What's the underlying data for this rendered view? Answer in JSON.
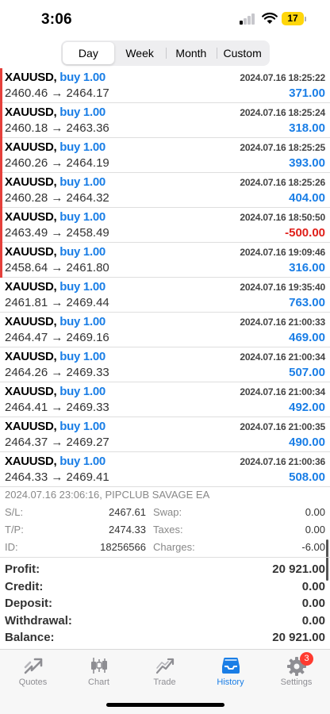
{
  "status_bar": {
    "time": "3:06",
    "battery": "17"
  },
  "colors": {
    "accent": "#1a7ee6",
    "loss": "#e0201b",
    "marker": "#e5403b"
  },
  "period_tabs": [
    {
      "label": "Day",
      "active": true
    },
    {
      "label": "Week",
      "active": false
    },
    {
      "label": "Month",
      "active": false
    },
    {
      "label": "Custom",
      "active": false
    }
  ],
  "deals": [
    {
      "symbol": "XAUUSD,",
      "action": "buy 1.00",
      "time": "2024.07.16 18:25:22",
      "price": "2460.46 → 2464.17",
      "profit": "371.00",
      "marked": true
    },
    {
      "symbol": "XAUUSD,",
      "action": "buy 1.00",
      "time": "2024.07.16 18:25:24",
      "price": "2460.18 → 2463.36",
      "profit": "318.00",
      "marked": true
    },
    {
      "symbol": "XAUUSD,",
      "action": "buy 1.00",
      "time": "2024.07.16 18:25:25",
      "price": "2460.26 → 2464.19",
      "profit": "393.00",
      "marked": true
    },
    {
      "symbol": "XAUUSD,",
      "action": "buy 1.00",
      "time": "2024.07.16 18:25:26",
      "price": "2460.28 → 2464.32",
      "profit": "404.00",
      "marked": true
    },
    {
      "symbol": "XAUUSD,",
      "action": "buy 1.00",
      "time": "2024.07.16 18:50:50",
      "price": "2463.49 → 2458.49",
      "profit": "-500.00",
      "marked": true
    },
    {
      "symbol": "XAUUSD,",
      "action": "buy 1.00",
      "time": "2024.07.16 19:09:46",
      "price": "2458.64 → 2461.80",
      "profit": "316.00",
      "marked": true
    },
    {
      "symbol": "XAUUSD,",
      "action": "buy 1.00",
      "time": "2024.07.16 19:35:40",
      "price": "2461.81 → 2469.44",
      "profit": "763.00",
      "marked": false
    },
    {
      "symbol": "XAUUSD,",
      "action": "buy 1.00",
      "time": "2024.07.16 21:00:33",
      "price": "2464.47 → 2469.16",
      "profit": "469.00",
      "marked": false
    },
    {
      "symbol": "XAUUSD,",
      "action": "buy 1.00",
      "time": "2024.07.16 21:00:34",
      "price": "2464.26 → 2469.33",
      "profit": "507.00",
      "marked": false
    },
    {
      "symbol": "XAUUSD,",
      "action": "buy 1.00",
      "time": "2024.07.16 21:00:34",
      "price": "2464.41 → 2469.33",
      "profit": "492.00",
      "marked": false
    },
    {
      "symbol": "XAUUSD,",
      "action": "buy 1.00",
      "time": "2024.07.16 21:00:35",
      "price": "2464.37 → 2469.27",
      "profit": "490.00",
      "marked": false
    },
    {
      "symbol": "XAUUSD,",
      "action": "buy 1.00",
      "time": "2024.07.16 21:00:36",
      "price": "2464.33 → 2469.41",
      "profit": "508.00",
      "marked": false
    }
  ],
  "detail": {
    "header": "2024.07.16 23:06:16, PIPCLUB SAVAGE EA",
    "sl_label": "S/L:",
    "sl_value": "2467.61",
    "tp_label": "T/P:",
    "tp_value": "2474.33",
    "id_label": "ID:",
    "id_value": "18256566",
    "swap_label": "Swap:",
    "swap_value": "0.00",
    "taxes_label": "Taxes:",
    "taxes_value": "0.00",
    "charges_label": "Charges:",
    "charges_value": "-6.00"
  },
  "summary": [
    {
      "label": "Profit:",
      "value": "20 921.00"
    },
    {
      "label": "Credit:",
      "value": "0.00"
    },
    {
      "label": "Deposit:",
      "value": "0.00"
    },
    {
      "label": "Withdrawal:",
      "value": "0.00"
    },
    {
      "label": "Balance:",
      "value": "20 921.00"
    }
  ],
  "tab_bar": {
    "quotes": "Quotes",
    "chart": "Chart",
    "trade": "Trade",
    "history": "History",
    "settings": "Settings",
    "settings_badge": "3"
  },
  "icons": [
    "signal-icon",
    "wifi-icon",
    "battery-icon",
    "quotes-icon",
    "chart-icon",
    "trade-icon",
    "history-icon",
    "settings-icon"
  ]
}
